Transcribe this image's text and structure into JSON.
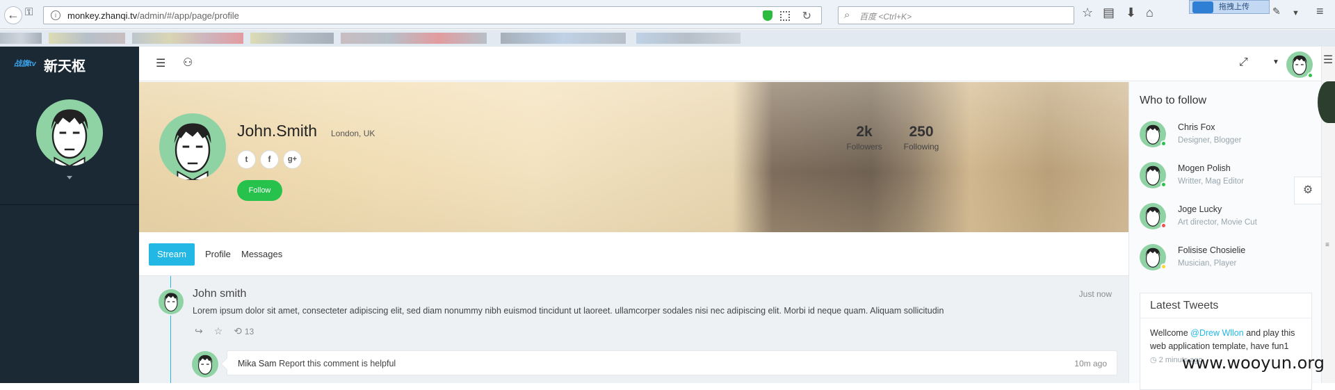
{
  "browser": {
    "url_host": "monkey.zhanqi.tv",
    "url_path": "/admin/#/app/page/profile",
    "search_placeholder": "百度 <Ctrl+K>",
    "upload_label": "拖拽上传"
  },
  "brand": {
    "logo_text": "战旗tv",
    "name": "新天枢"
  },
  "profile": {
    "name": "John.Smith",
    "location": "London, UK",
    "follow_label": "Follow",
    "followers_count": "2k",
    "followers_label": "Followers",
    "following_count": "250",
    "following_label": "Following",
    "social": [
      "twitter-icon",
      "facebook-icon",
      "google-plus-icon"
    ]
  },
  "tabs": [
    "Stream",
    "Profile",
    "Messages"
  ],
  "post": {
    "author": "John smith",
    "time": "Just now",
    "text": "Lorem ipsum dolor sit amet, consecteter adipiscing elit, sed diam nonummy nibh euismod tincidunt ut laoreet. ullamcorper sodales nisi nec adipiscing elit. Morbi id neque quam. Aliquam sollicitudin",
    "retweet_count": "13"
  },
  "comment": {
    "author": "Mika Sam",
    "text": "Report this comment is helpful",
    "time": "10m ago"
  },
  "who_to_follow": {
    "title": "Who to follow",
    "people": [
      {
        "name": "Chris Fox",
        "role": "Designer, Blogger",
        "status_color": "#27c24c"
      },
      {
        "name": "Mogen Polish",
        "role": "Writter, Mag Editor",
        "status_color": "#27c24c"
      },
      {
        "name": "Joge Lucky",
        "role": "Art director, Movie Cut",
        "status_color": "#f05050"
      },
      {
        "name": "Folisise Chosielie",
        "role": "Musician, Player",
        "status_color": "#fad733"
      }
    ]
  },
  "latest_tweets": {
    "title": "Latest Tweets",
    "text_before": "Wellcome ",
    "mention": "@Drew Wllon",
    "text_after": " and play this web application template, have fun1",
    "meta": "2 minuts ago"
  },
  "watermark": "www.wooyun.org",
  "colors": {
    "accent": "#23b7e5",
    "success": "#27c24c",
    "sidebar_bg": "#1b2934"
  }
}
